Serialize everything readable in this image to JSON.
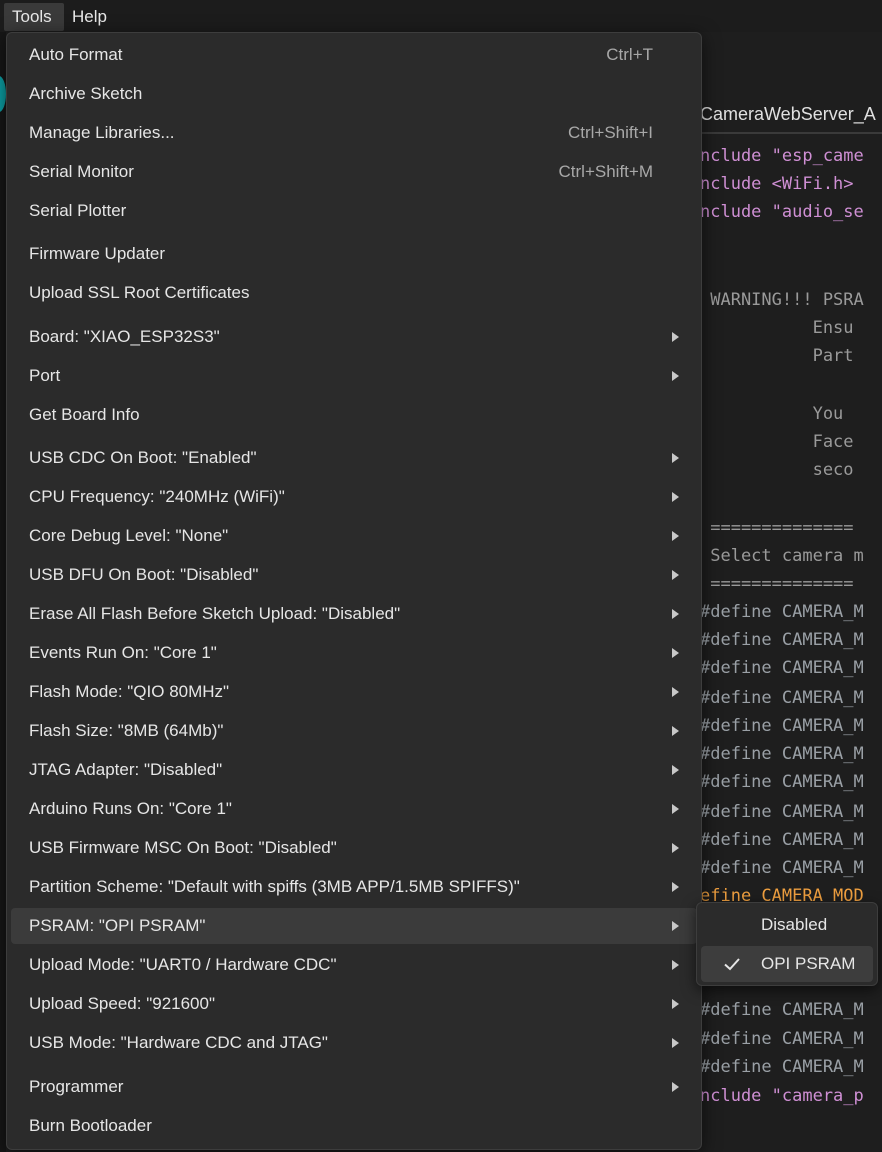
{
  "menubar": {
    "items": [
      "Tools",
      "Help"
    ]
  },
  "editor": {
    "tab_title": "CameraWebServer_A",
    "code_lines": [
      "nclude \"esp_came",
      "nclude <WiFi.h>",
      "nclude \"audio_se",
      " WARNING!!! PSRA",
      "           Ensu",
      "           Part",
      "           You ",
      "           Face",
      "           seco",
      " ==============",
      " Select camera m",
      " ==============",
      "#define CAMERA_M",
      "efine CAMERA_MOD",
      "nclude \"camera_p"
    ]
  },
  "tools_menu": {
    "items": [
      {
        "label": "Auto Format",
        "shortcut": "Ctrl+T"
      },
      {
        "label": "Archive Sketch"
      },
      {
        "label": "Manage Libraries...",
        "shortcut": "Ctrl+Shift+I"
      },
      {
        "label": "Serial Monitor",
        "shortcut": "Ctrl+Shift+M"
      },
      {
        "label": "Serial Plotter"
      },
      {
        "label": "Firmware Updater"
      },
      {
        "label": "Upload SSL Root Certificates"
      },
      {
        "label": "Board: \"XIAO_ESP32S3\"",
        "submenu": true
      },
      {
        "label": "Port",
        "submenu": true
      },
      {
        "label": "Get Board Info"
      },
      {
        "label": "USB CDC On Boot: \"Enabled\"",
        "submenu": true
      },
      {
        "label": "CPU Frequency: \"240MHz (WiFi)\"",
        "submenu": true
      },
      {
        "label": "Core Debug Level: \"None\"",
        "submenu": true
      },
      {
        "label": "USB DFU On Boot: \"Disabled\"",
        "submenu": true
      },
      {
        "label": "Erase All Flash Before Sketch Upload: \"Disabled\"",
        "submenu": true
      },
      {
        "label": "Events Run On: \"Core 1\"",
        "submenu": true
      },
      {
        "label": "Flash Mode: \"QIO 80MHz\"",
        "submenu": true
      },
      {
        "label": "Flash Size: \"8MB (64Mb)\"",
        "submenu": true
      },
      {
        "label": "JTAG Adapter: \"Disabled\"",
        "submenu": true
      },
      {
        "label": "Arduino Runs On: \"Core 1\"",
        "submenu": true
      },
      {
        "label": "USB Firmware MSC On Boot: \"Disabled\"",
        "submenu": true
      },
      {
        "label": "Partition Scheme: \"Default with spiffs (3MB APP/1.5MB SPIFFS)\"",
        "submenu": true
      },
      {
        "label": "PSRAM: \"OPI PSRAM\"",
        "submenu": true
      },
      {
        "label": "Upload Mode: \"UART0 / Hardware CDC\"",
        "submenu": true
      },
      {
        "label": "Upload Speed: \"921600\"",
        "submenu": true
      },
      {
        "label": "USB Mode: \"Hardware CDC and JTAG\"",
        "submenu": true
      },
      {
        "label": "Programmer",
        "submenu": true
      },
      {
        "label": "Burn Bootloader"
      }
    ]
  },
  "psram_submenu": {
    "options": [
      {
        "label": "Disabled",
        "checked": false
      },
      {
        "label": "OPI PSRAM",
        "checked": true
      }
    ]
  }
}
